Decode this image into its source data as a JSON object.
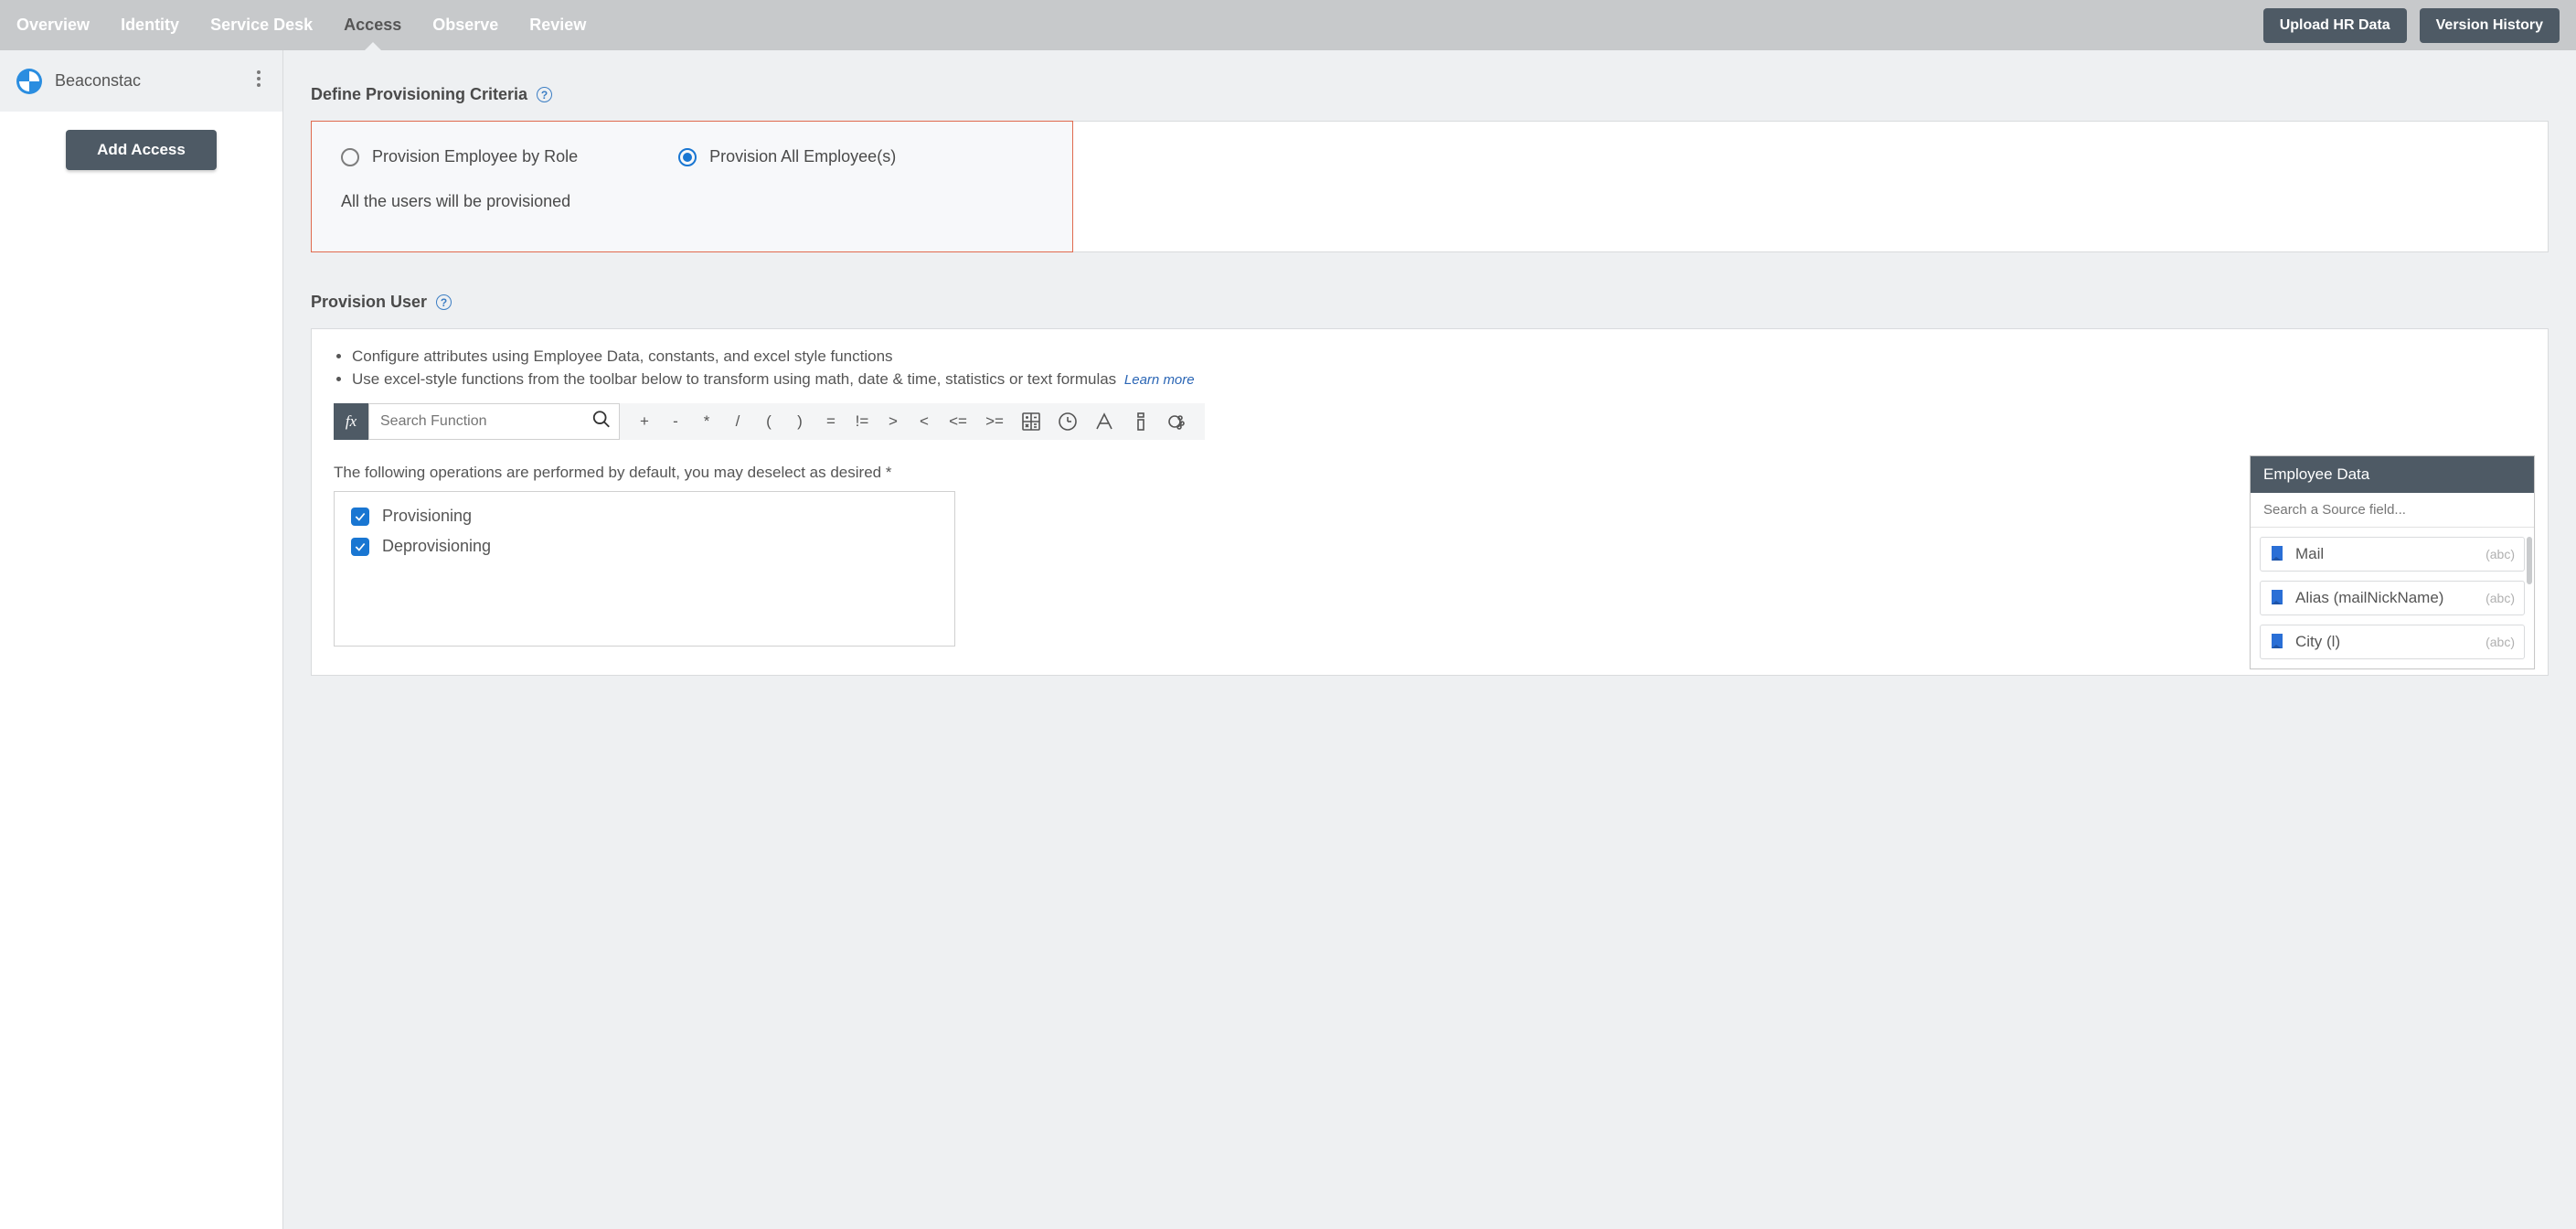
{
  "nav": {
    "tabs": [
      "Overview",
      "Identity",
      "Service Desk",
      "Access",
      "Observe",
      "Review"
    ],
    "active_index": 3,
    "upload_btn": "Upload HR Data",
    "version_btn": "Version History"
  },
  "sidebar": {
    "app_name": "Beaconstac",
    "add_access_btn": "Add Access"
  },
  "criteria": {
    "title": "Define Provisioning Criteria",
    "option_by_role": "Provision Employee by Role",
    "option_all": "Provision All Employee(s)",
    "selected": "all",
    "description": "All the users will be provisioned"
  },
  "provision_user": {
    "title": "Provision User",
    "bullet1": "Configure attributes using Employee Data, constants, and excel style functions",
    "bullet2": "Use excel-style functions from the toolbar below to transform using math, date & time, statistics or text formulas",
    "learn_more": "Learn more",
    "search_placeholder": "Search Function",
    "operators": [
      "+",
      "-",
      "*",
      "/",
      "(",
      ")",
      "=",
      "!=",
      ">",
      "<",
      "<=",
      ">="
    ],
    "ops_note": "The following operations are performed by default, you may deselect as desired *",
    "checkbox_provisioning": "Provisioning",
    "checkbox_deprovisioning": "Deprovisioning"
  },
  "employee_data": {
    "header": "Employee Data",
    "search_placeholder": "Search a Source field...",
    "fields": [
      {
        "label": "Mail",
        "type": "(abc)"
      },
      {
        "label": "Alias (mailNickName)",
        "type": "(abc)"
      },
      {
        "label": "City (l)",
        "type": "(abc)"
      }
    ]
  }
}
